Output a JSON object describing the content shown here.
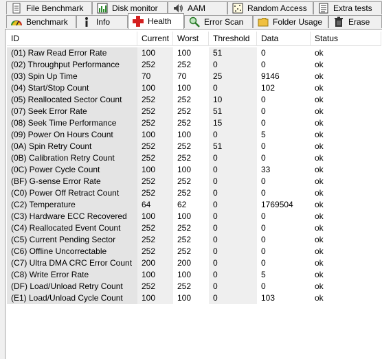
{
  "tabs_row1": [
    {
      "label": "File Benchmark",
      "icon": "document-icon"
    },
    {
      "label": "Disk monitor",
      "icon": "bar-chart-icon"
    },
    {
      "label": "AAM",
      "icon": "speaker-icon"
    },
    {
      "label": "Random Access",
      "icon": "random-dots-icon"
    },
    {
      "label": "Extra tests",
      "icon": "checklist-icon"
    }
  ],
  "tabs_row2": [
    {
      "label": "Benchmark",
      "icon": "speedometer-icon"
    },
    {
      "label": "Info",
      "icon": "info-icon"
    },
    {
      "label": "Health",
      "icon": "health-cross-icon"
    },
    {
      "label": "Error Scan",
      "icon": "magnifier-icon"
    },
    {
      "label": "Folder Usage",
      "icon": "folder-icon"
    },
    {
      "label": "Erase",
      "icon": "trash-icon"
    }
  ],
  "active_tab": "Health",
  "colors": {
    "health_red": "#d42020",
    "id_shade": "#e4e4e4",
    "cell_shade": "#efefef"
  },
  "table": {
    "columns": [
      "ID",
      "Current",
      "Worst",
      "Threshold",
      "Data",
      "Status"
    ],
    "rows": [
      [
        "(01) Raw Read Error Rate",
        "100",
        "100",
        "51",
        "0",
        "ok"
      ],
      [
        "(02) Throughput Performance",
        "252",
        "252",
        "0",
        "0",
        "ok"
      ],
      [
        "(03) Spin Up Time",
        "70",
        "70",
        "25",
        "9146",
        "ok"
      ],
      [
        "(04) Start/Stop Count",
        "100",
        "100",
        "0",
        "102",
        "ok"
      ],
      [
        "(05) Reallocated Sector Count",
        "252",
        "252",
        "10",
        "0",
        "ok"
      ],
      [
        "(07) Seek Error Rate",
        "252",
        "252",
        "51",
        "0",
        "ok"
      ],
      [
        "(08) Seek Time Performance",
        "252",
        "252",
        "15",
        "0",
        "ok"
      ],
      [
        "(09) Power On Hours Count",
        "100",
        "100",
        "0",
        "5",
        "ok"
      ],
      [
        "(0A) Spin Retry Count",
        "252",
        "252",
        "51",
        "0",
        "ok"
      ],
      [
        "(0B) Calibration Retry Count",
        "252",
        "252",
        "0",
        "0",
        "ok"
      ],
      [
        "(0C) Power Cycle Count",
        "100",
        "100",
        "0",
        "33",
        "ok"
      ],
      [
        "(BF) G-sense Error Rate",
        "252",
        "252",
        "0",
        "0",
        "ok"
      ],
      [
        "(C0) Power Off Retract Count",
        "252",
        "252",
        "0",
        "0",
        "ok"
      ],
      [
        "(C2) Temperature",
        "64",
        "62",
        "0",
        "1769504",
        "ok"
      ],
      [
        "(C3) Hardware ECC Recovered",
        "100",
        "100",
        "0",
        "0",
        "ok"
      ],
      [
        "(C4) Reallocated Event Count",
        "252",
        "252",
        "0",
        "0",
        "ok"
      ],
      [
        "(C5) Current Pending Sector",
        "252",
        "252",
        "0",
        "0",
        "ok"
      ],
      [
        "(C6) Offline Uncorrectable",
        "252",
        "252",
        "0",
        "0",
        "ok"
      ],
      [
        "(C7) Ultra DMA CRC Error Count",
        "200",
        "200",
        "0",
        "0",
        "ok"
      ],
      [
        "(C8) Write Error Rate",
        "100",
        "100",
        "0",
        "5",
        "ok"
      ],
      [
        "(DF) Load/Unload Retry Count",
        "252",
        "252",
        "0",
        "0",
        "ok"
      ],
      [
        "(E1) Load/Unload Cycle Count",
        "100",
        "100",
        "0",
        "103",
        "ok"
      ]
    ]
  }
}
